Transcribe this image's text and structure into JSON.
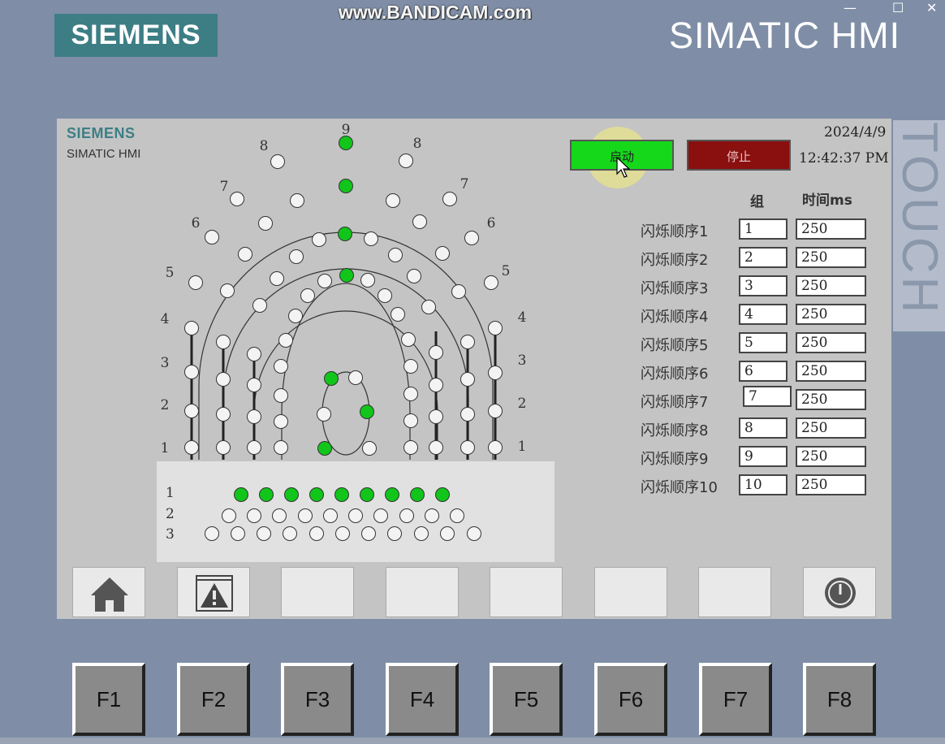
{
  "device": {
    "brand": "SIEMENS",
    "title": "SIMATIC HMI"
  },
  "watermark": "www.BANDICAM.com",
  "window_controls": {
    "minimize": "—",
    "maximize": "☐",
    "close": "✕"
  },
  "touch_label": "TOUCH",
  "screen": {
    "brand": "SIEMENS",
    "subtitle": "SIMATIC HMI",
    "start_label": "启动",
    "stop_label": "停止",
    "date": "2024/4/9",
    "time": "12:42:37 PM",
    "col_group": "组",
    "col_time": "时间ms",
    "sequences": [
      {
        "label": "闪烁顺序1",
        "group": "1",
        "time": "250"
      },
      {
        "label": "闪烁顺序2",
        "group": "2",
        "time": "250"
      },
      {
        "label": "闪烁顺序3",
        "group": "3",
        "time": "250"
      },
      {
        "label": "闪烁顺序4",
        "group": "4",
        "time": "250"
      },
      {
        "label": "闪烁顺序5",
        "group": "5",
        "time": "250"
      },
      {
        "label": "闪烁顺序6",
        "group": "6",
        "time": "250"
      },
      {
        "label": "闪烁顺序7",
        "group": "7",
        "time": "250"
      },
      {
        "label": "闪烁顺序8",
        "group": "8",
        "time": "250"
      },
      {
        "label": "闪烁顺序9",
        "group": "9",
        "time": "250"
      },
      {
        "label": "闪烁顺序10",
        "group": "10",
        "time": "250"
      }
    ],
    "ring_numbers": [
      "1",
      "2",
      "3",
      "4",
      "5",
      "6",
      "7",
      "8",
      "9"
    ],
    "row_numbers": [
      "1",
      "2",
      "3"
    ],
    "lamp_on_color": "#11c51b",
    "lamp_off_color": "#f3f3f3"
  },
  "nav_buttons": [
    {
      "icon": "home-icon"
    },
    {
      "icon": "alarm-warning-icon"
    },
    {
      "icon": ""
    },
    {
      "icon": ""
    },
    {
      "icon": ""
    },
    {
      "icon": ""
    },
    {
      "icon": ""
    },
    {
      "icon": "power-icon"
    }
  ],
  "function_keys": [
    "F1",
    "F2",
    "F3",
    "F4",
    "F5",
    "F6",
    "F7",
    "F8"
  ]
}
